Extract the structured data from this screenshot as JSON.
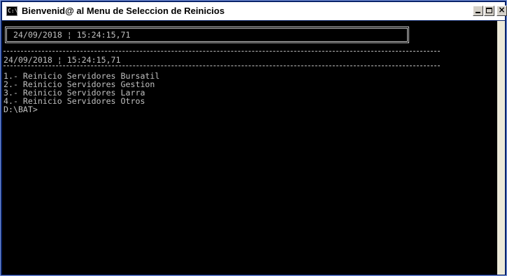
{
  "window": {
    "title": "Bienvenid@ al Menu de Seleccion de Reinicios",
    "icon": "console-icon",
    "icon_label": "C:\\",
    "controls": {
      "minimize": "minimize-icon",
      "maximize": "maximize-icon",
      "close": "close-icon",
      "close_glyph": "×"
    }
  },
  "console": {
    "boxed_datetime": "24/09/2018 ¦ 15:24:15,71",
    "datetime": "24/09/2018 ¦ 15:24:15,71",
    "options": [
      "1.- Reinicio Servidores Bursatil",
      "2.- Reinicio Servidores Gestion",
      "3.- Reinicio Servidores Larra",
      "4.- Reinicio Servidores Otros"
    ],
    "prompt": "D:\\BAT>"
  },
  "colors": {
    "console_bg": "#000000",
    "console_fg": "#c0c0c0",
    "titlebar_bg": "#ffffff"
  }
}
